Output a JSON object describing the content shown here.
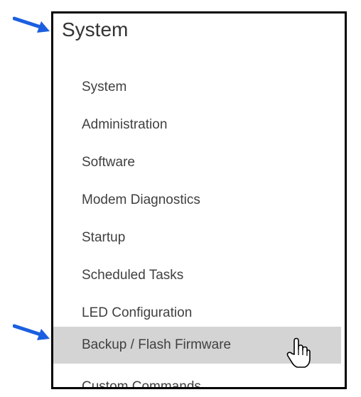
{
  "menu": {
    "header": "System",
    "items": [
      {
        "label": "System",
        "selected": false
      },
      {
        "label": "Administration",
        "selected": false
      },
      {
        "label": "Software",
        "selected": false
      },
      {
        "label": "Modem Diagnostics",
        "selected": false
      },
      {
        "label": "Startup",
        "selected": false
      },
      {
        "label": "Scheduled Tasks",
        "selected": false
      },
      {
        "label": "LED Configuration",
        "selected": false
      },
      {
        "label": "Backup / Flash Firmware",
        "selected": true
      },
      {
        "label": "Custom Commands",
        "selected": false
      }
    ]
  },
  "annotations": {
    "arrow_color": "#1b5fe0",
    "arrow_targets": [
      "menu-header",
      "menu-item-backup-flash-firmware"
    ]
  },
  "pointer": {
    "icon": "hand-pointer-icon"
  },
  "colors": {
    "frame_border": "#000000",
    "selected_background": "#d4d4d4",
    "text": "#404040"
  }
}
